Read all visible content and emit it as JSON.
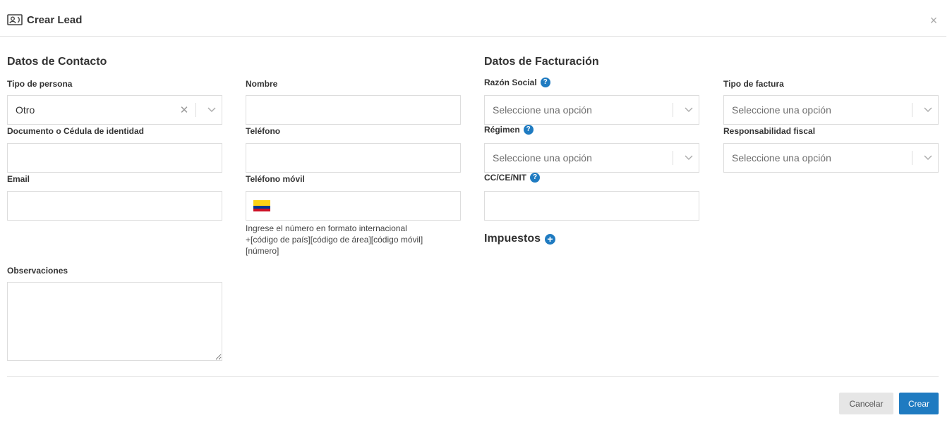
{
  "header": {
    "title": "Crear Lead",
    "icon": "contact-card-icon",
    "close_label": "×"
  },
  "contact": {
    "section_title": "Datos de Contacto",
    "tipo_persona": {
      "label": "Tipo de persona",
      "value": "Otro"
    },
    "nombre": {
      "label": "Nombre",
      "value": ""
    },
    "documento": {
      "label": "Documento o Cédula de identidad",
      "value": ""
    },
    "telefono": {
      "label": "Teléfono",
      "value": ""
    },
    "email": {
      "label": "Email",
      "value": ""
    },
    "telefono_movil": {
      "label": "Teléfono móvil",
      "value": "",
      "flag": "colombia-flag-icon",
      "hint_line1": "Ingrese el número en formato internacional",
      "hint_line2": "+[código de país][código de área][código móvil]",
      "hint_line3": "[número]"
    },
    "observaciones": {
      "label": "Observaciones",
      "value": ""
    }
  },
  "billing": {
    "section_title": "Datos de Facturación",
    "razon_social": {
      "label": "Razón Social",
      "placeholder": "Seleccione una opción"
    },
    "tipo_factura": {
      "label": "Tipo de factura",
      "placeholder": "Seleccione una opción"
    },
    "regimen": {
      "label": "Régimen",
      "placeholder": "Seleccione una opción"
    },
    "responsabilidad_fiscal": {
      "label": "Responsabilidad fiscal",
      "placeholder": "Seleccione una opción"
    },
    "cc_ce_nit": {
      "label": "CC/CE/NIT",
      "value": ""
    },
    "impuestos": {
      "label": "Impuestos"
    }
  },
  "footer": {
    "cancel_label": "Cancelar",
    "create_label": "Crear"
  },
  "colors": {
    "primary": "#1f7bc1",
    "border": "#dddddd",
    "cancel_bg": "#e6e6e6"
  }
}
